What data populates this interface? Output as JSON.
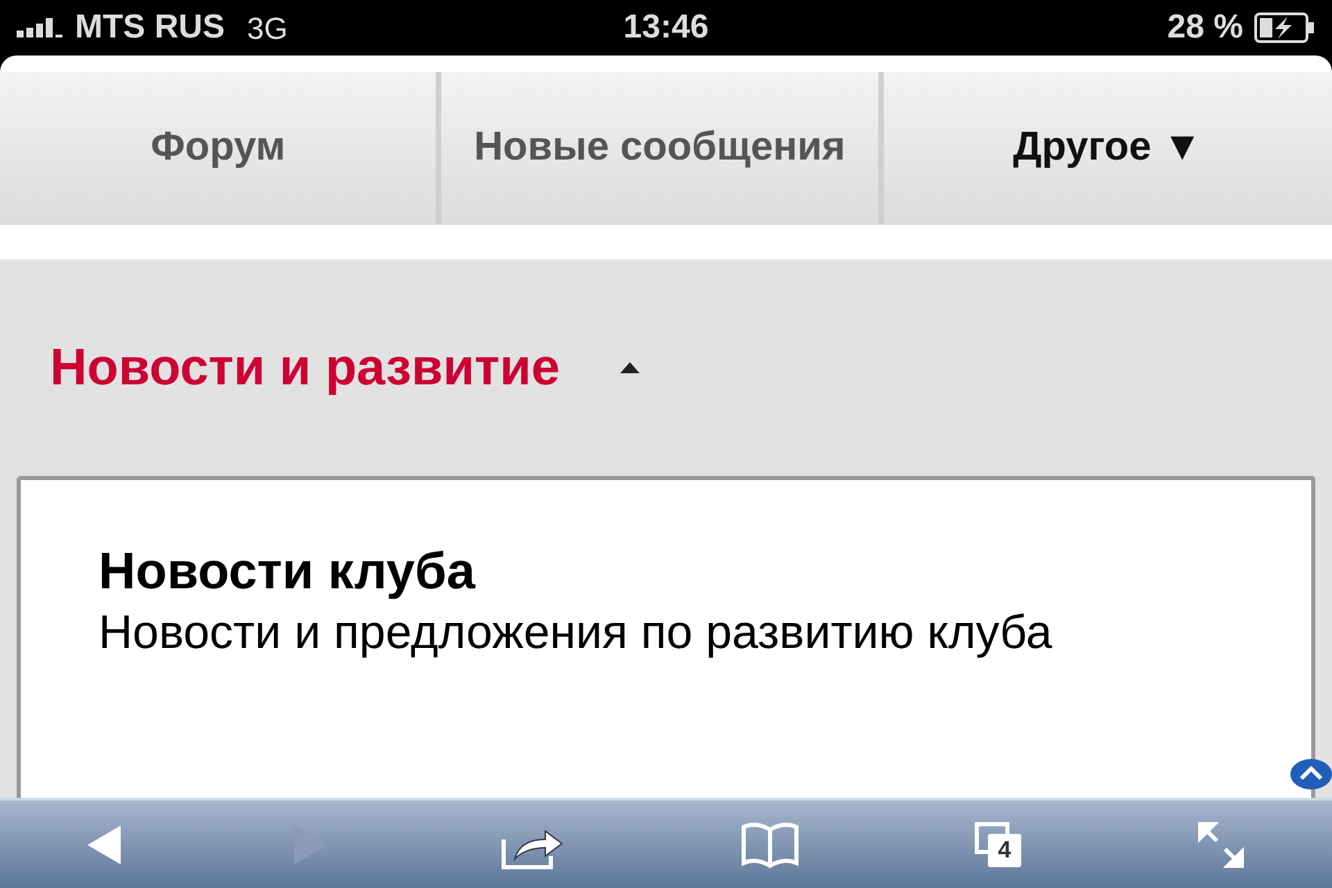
{
  "status_bar": {
    "carrier": "MTS RUS",
    "network": "3G",
    "time": "13:46",
    "battery": "28 %",
    "charging": true
  },
  "tabs": [
    {
      "label": "Форум",
      "selected": false
    },
    {
      "label": "Новые сообщения",
      "selected": false
    },
    {
      "label": "Другое ▼",
      "selected": true
    }
  ],
  "section": {
    "title": "Новости и развитие",
    "expanded": true
  },
  "forums": [
    {
      "title": "Новости клуба",
      "description": "Новости и предложения по развитию клуба"
    }
  ],
  "toolbar": {
    "back_disabled": false,
    "forward_disabled": true,
    "tab_count": "4"
  }
}
